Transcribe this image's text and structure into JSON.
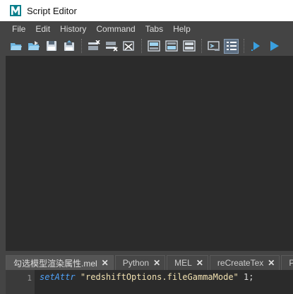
{
  "window": {
    "title": "Script Editor",
    "icon": "maya-m-icon"
  },
  "menu": [
    "File",
    "Edit",
    "History",
    "Command",
    "Tabs",
    "Help"
  ],
  "colors": {
    "background": "#444444",
    "panel": "#2b2b2b",
    "keyword": "#4ea0f7",
    "string": "#f0e0b0",
    "play": "#3aa0e0"
  },
  "tabs": [
    {
      "label": "勾选模型渲染属性.mel",
      "active": true
    },
    {
      "label": "Python",
      "active": false
    },
    {
      "label": "MEL",
      "active": false
    },
    {
      "label": "reCreateTex",
      "active": false
    },
    {
      "label": "P",
      "active": false
    }
  ],
  "editor": {
    "line_number": "1",
    "code": {
      "command": "setAttr",
      "space": " ",
      "string": "\"redshiftOptions.fileGammaMode\"",
      "rest": " 1;"
    }
  }
}
